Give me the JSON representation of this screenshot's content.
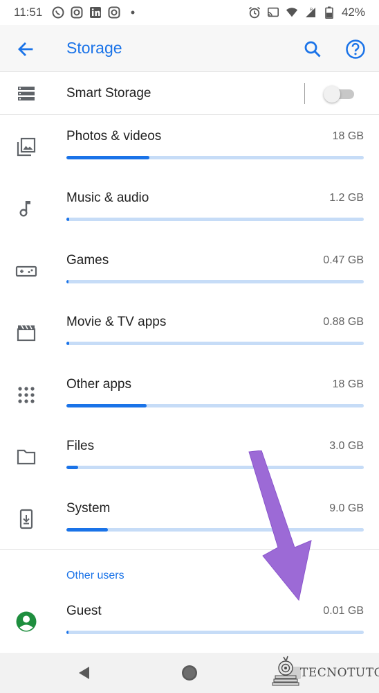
{
  "status_bar": {
    "time": "11:51",
    "notification_icons": [
      "whatsapp-icon",
      "instagram-icon",
      "linkedin-icon",
      "instagram-icon"
    ],
    "system_icons": [
      "alarm-icon",
      "cast-icon",
      "wifi-icon",
      "signal-icon",
      "battery-icon"
    ],
    "battery": "42%"
  },
  "app_bar": {
    "title": "Storage",
    "accent_color": "#1a73e8"
  },
  "smart_storage": {
    "label": "Smart Storage",
    "enabled": false
  },
  "categories": [
    {
      "label": "Photos & videos",
      "size": "18 GB",
      "usage_fraction": 0.28,
      "icon": "photo-library-icon"
    },
    {
      "label": "Music & audio",
      "size": "1.2 GB",
      "usage_fraction": 0.01,
      "icon": "music-note-icon"
    },
    {
      "label": "Games",
      "size": "0.47 GB",
      "usage_fraction": 0.0,
      "icon": "gamepad-icon"
    },
    {
      "label": "Movie & TV apps",
      "size": "0.88 GB",
      "usage_fraction": 0.01,
      "icon": "movie-icon"
    },
    {
      "label": "Other apps",
      "size": "18 GB",
      "usage_fraction": 0.27,
      "icon": "apps-grid-icon"
    },
    {
      "label": "Files",
      "size": "3.0 GB",
      "usage_fraction": 0.04,
      "icon": "folder-icon"
    },
    {
      "label": "System",
      "size": "9.0 GB",
      "usage_fraction": 0.14,
      "icon": "system-update-icon"
    }
  ],
  "other_users": {
    "section_title": "Other users",
    "users": [
      {
        "label": "Guest",
        "size": "0.01 GB",
        "usage_fraction": 0.0,
        "icon": "account-circle-icon",
        "icon_color": "#1e8e3e"
      }
    ]
  },
  "nav_bar": {
    "buttons": [
      "back-triangle-icon",
      "home-circle-icon",
      "overview-square-icon"
    ]
  },
  "watermark": {
    "text": "TECNOTUTO"
  },
  "annotation_arrow_color": "#9c6ad6"
}
